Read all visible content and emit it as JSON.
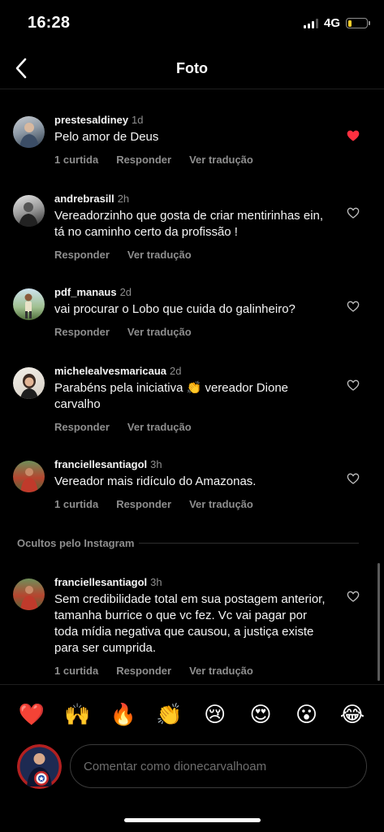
{
  "status": {
    "time": "16:28",
    "network": "4G",
    "battery_level": 0.2,
    "battery_color": "#f7ce2a"
  },
  "nav": {
    "title": "Foto",
    "back_icon": "chevron-left-icon"
  },
  "comments": [
    {
      "username": "prestesaldiney",
      "time": "1d",
      "text": "Pelo amor de Deus",
      "actions": [
        "1 curtida",
        "Responder",
        "Ver tradução"
      ],
      "liked": true
    },
    {
      "username": "andrebrasill",
      "time": "2h",
      "text": "Vereadorzinho que gosta de criar mentirinhas ein, tá no caminho certo da profissão !",
      "actions": [
        "Responder",
        "Ver tradução"
      ],
      "liked": false
    },
    {
      "username": "pdf_manaus",
      "time": "2d",
      "text": "vai procurar o Lobo que cuida do galinheiro?",
      "actions": [
        "Responder",
        "Ver tradução"
      ],
      "liked": false
    },
    {
      "username": "michelealvesmaricaua",
      "time": "2d",
      "text": "Parabéns pela iniciativa 👏 vereador Dione carvalho",
      "actions": [
        "Responder",
        "Ver tradução"
      ],
      "liked": false
    },
    {
      "username": "franciellesantiagol",
      "time": "3h",
      "text": "Vereador mais ridículo do Amazonas.",
      "actions": [
        "1 curtida",
        "Responder",
        "Ver tradução"
      ],
      "liked": false
    }
  ],
  "hidden_section": {
    "label": "Ocultos pelo Instagram"
  },
  "hidden_comments": [
    {
      "username": "franciellesantiagol",
      "time": "3h",
      "text": "Sem credibilidade total em sua postagem anterior, tamanha burrice o que vc fez.  Vc vai pagar por toda mídia negativa que causou, a justiça existe para ser cumprida.",
      "actions": [
        "1 curtida",
        "Responder",
        "Ver tradução"
      ],
      "liked": false
    }
  ],
  "emoji_bar": [
    "❤️",
    "🙌",
    "🔥",
    "👏",
    "😢",
    "😍",
    "😮",
    "😂"
  ],
  "composer": {
    "placeholder": "Comentar como dionecarvalhoam"
  },
  "colors": {
    "background": "#000000",
    "secondary_text": "#8e8e8e",
    "like_red": "#ff3040"
  }
}
